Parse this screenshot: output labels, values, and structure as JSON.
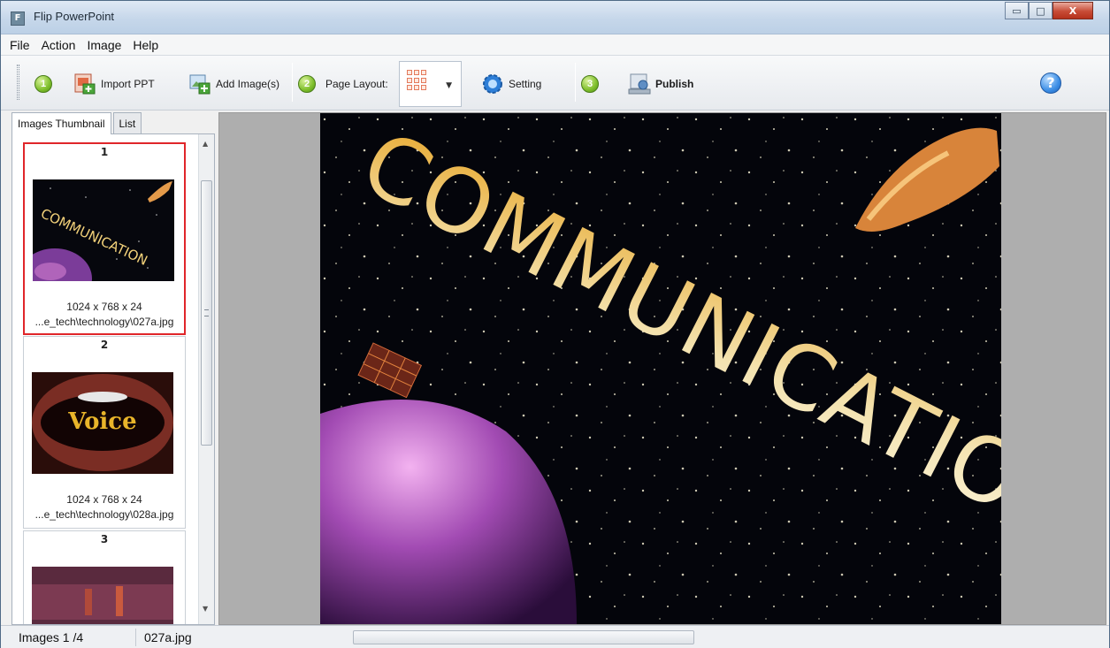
{
  "window": {
    "title": "Flip PowerPoint",
    "app_icon": "F"
  },
  "window_controls": {
    "minimize": "▭",
    "maximize": "□",
    "close": "X"
  },
  "menu": [
    "File",
    "Action",
    "Image",
    "Help"
  ],
  "toolbar": {
    "step1": "1",
    "step2": "2",
    "step3": "3",
    "import_ppt": "Import PPT",
    "add_images": "Add Image(s)",
    "page_layout": "Page Layout:",
    "setting": "Setting",
    "publish": "Publish",
    "help": "?"
  },
  "tabs": {
    "thumbnail": "Images Thumbnail",
    "list": "List"
  },
  "thumbnails": [
    {
      "num": "1",
      "size": "1024 x 768 x 24",
      "path": "...e_tech\\technology\\027a.jpg",
      "art": "COMMUNICATION"
    },
    {
      "num": "2",
      "size": "1024 x 768 x 24",
      "path": "...e_tech\\technology\\028a.jpg",
      "art": "Voice"
    },
    {
      "num": "3"
    }
  ],
  "preview": {
    "art": "COMMUNICATION"
  },
  "status": {
    "count": "Images 1 /4",
    "file": "027a.jpg"
  },
  "colors": {
    "selection": "#e0262a",
    "accent_green": "#7fbf2c",
    "accent_blue": "#3d8fe6"
  },
  "icons": [
    "app-icon",
    "minimize-icon",
    "maximize-icon",
    "close-icon",
    "import-ppt-icon",
    "add-image-icon",
    "layout-grid-icon",
    "chevron-down-icon",
    "setting-icon",
    "publish-icon",
    "help-icon"
  ]
}
